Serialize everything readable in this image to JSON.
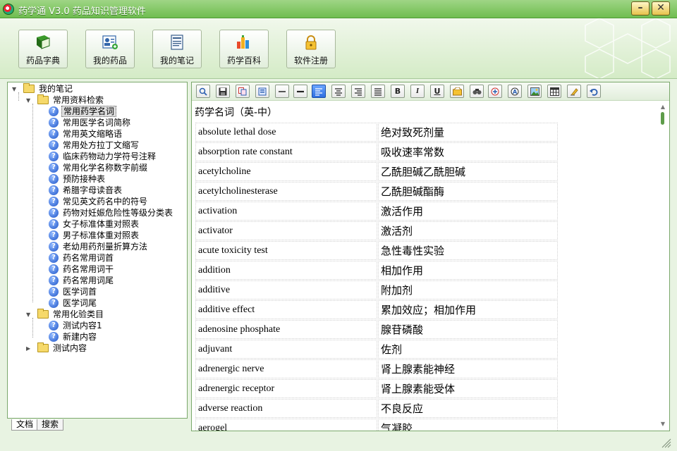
{
  "window": {
    "title": "药学通 V3.0 药品知识管理软件",
    "minimize_label": "–",
    "close_label": "✕"
  },
  "main_toolbar": {
    "buttons": [
      {
        "label": "药品字典",
        "icon": "book-icon"
      },
      {
        "label": "我的药品",
        "icon": "id-card-icon"
      },
      {
        "label": "我的笔记",
        "icon": "notepad-icon"
      },
      {
        "label": "药学百科",
        "icon": "chart-blocks-icon"
      },
      {
        "label": "软件注册",
        "icon": "lock-icon"
      }
    ]
  },
  "tree": {
    "root": "我的笔记",
    "group1": "常用资料检索",
    "group1_items": [
      "常用药学名词",
      "常用医学名词简称",
      "常用英文缩略语",
      "常用处方拉丁文缩写",
      "临床药物动力学符号注释",
      "常用化学名称数字前缀",
      "预防接种表",
      "希腊字母读音表",
      "常见英文药名中的符号",
      "药物对妊娠危险性等级分类表",
      "女子标准体重对照表",
      "男子标准体重对照表",
      "老幼用药剂量折算方法",
      "药名常用词首",
      "药名常用词干",
      "药名常用词尾",
      "医学词首",
      "医学词尾"
    ],
    "group2": "常用化验类目",
    "group2_items": [
      "测试内容1",
      "新建内容"
    ],
    "group3": "测试内容",
    "selected": "常用药学名词"
  },
  "left_tabs": [
    "文档",
    "搜索"
  ],
  "editor_toolbar": {
    "bold": "B",
    "italic": "I",
    "underline": "U"
  },
  "document": {
    "title": "药学名词（英-中）",
    "rows": [
      [
        "absolute lethal dose",
        "绝对致死剂量"
      ],
      [
        "absorption rate constant",
        "吸收速率常数"
      ],
      [
        "acetylcholine",
        "乙酰胆碱乙酰胆碱"
      ],
      [
        "acetylcholinesterase",
        "乙酰胆碱酯酶"
      ],
      [
        "activation",
        "激活作用"
      ],
      [
        "activator",
        "激活剂"
      ],
      [
        "acute toxicity test",
        "急性毒性实验"
      ],
      [
        "addition",
        "相加作用"
      ],
      [
        "additive",
        "附加剂"
      ],
      [
        "additive effect",
        "累加效应；相加作用"
      ],
      [
        "adenosine phosphate",
        "腺苷磷酸"
      ],
      [
        "adjuvant",
        "佐剂"
      ],
      [
        "adrenergic nerve",
        "肾上腺素能神经"
      ],
      [
        "adrenergic receptor",
        "肾上腺素能受体"
      ],
      [
        "adverse reaction",
        "不良反应"
      ],
      [
        "aerogel",
        "气凝胶"
      ]
    ]
  },
  "colors": {
    "accent_green": "#6fbd50",
    "panel_border": "#7aa86b",
    "active_button": "#2e6fe0"
  }
}
